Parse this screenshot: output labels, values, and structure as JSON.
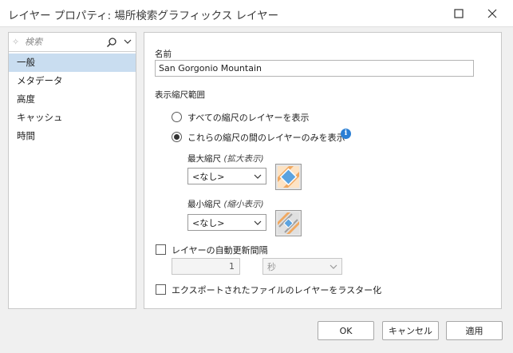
{
  "window": {
    "title": "レイヤー プロパティ: 場所検索グラフィックス レイヤー",
    "maximize_icon": "maximize-icon",
    "close_icon": "close-icon"
  },
  "sidebar": {
    "search_placeholder": "検索",
    "items": [
      {
        "label": "一般",
        "selected": true
      },
      {
        "label": "メタデータ",
        "selected": false
      },
      {
        "label": "高度",
        "selected": false
      },
      {
        "label": "キャッシュ",
        "selected": false
      },
      {
        "label": "時間",
        "selected": false
      }
    ]
  },
  "general": {
    "name_label": "名前",
    "name_value": "San Gorgonio Mountain",
    "scale_range_label": "表示縮尺範囲",
    "radio_all_label": "すべての縮尺のレイヤーを表示",
    "radio_all_checked": false,
    "radio_between_label": "これらの縮尺の間のレイヤーのみを表示",
    "radio_between_checked": true,
    "max_scale_label": "最大縮尺",
    "max_scale_hint": "(拡大表示)",
    "max_scale_value": "<なし>",
    "min_scale_label": "最小縮尺",
    "min_scale_hint": "(縮小表示)",
    "min_scale_value": "<なし>",
    "auto_refresh_label": "レイヤーの自動更新間隔",
    "auto_refresh_checked": false,
    "refresh_interval_value": "1",
    "refresh_unit_value": "秒",
    "rasterize_label": "エクスポートされたファイルのレイヤーをラスター化",
    "rasterize_checked": false
  },
  "buttons": {
    "ok": "OK",
    "cancel": "キャンセル",
    "apply": "適用"
  },
  "colors": {
    "selection": "#c9ddf0",
    "accent": "#2b7fd4",
    "scale_icon_orange": "#f0a860",
    "scale_icon_blue": "#5ba3e0"
  }
}
